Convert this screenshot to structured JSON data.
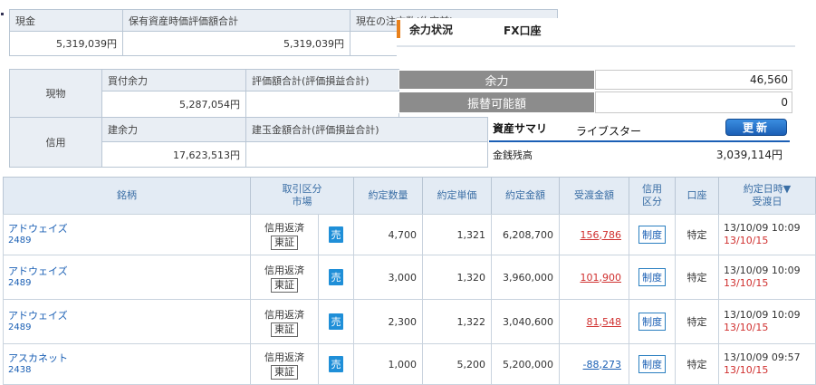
{
  "summary_top": {
    "cash_label": "現金",
    "cash_value": "5,319,039円",
    "holdings_label": "保有資産時価評価額合計",
    "holdings_value": "5,319,039円",
    "current_order_label": "現在の注文数(約定前)"
  },
  "margin_block": {
    "spot_label": "現物",
    "buy_power_label": "買付余力",
    "buy_power_value": "5,287,054円",
    "valuation_label": "評価額合計(評価損益合計)",
    "credit_label": "信用",
    "build_power_label": "建余力",
    "build_power_value": "17,623,513円",
    "position_label": "建玉金額合計(評価損益合計)"
  },
  "fx_panel": {
    "title": "余力状況",
    "account": "FX口座",
    "margin_label": "余力",
    "margin_value": "46,560",
    "transferable_label": "振替可能額",
    "transferable_value": "0",
    "asset_summary_label": "資産サマリ",
    "live_star": "ライブスター",
    "update_label": "更新",
    "cash_balance_label": "金銭残高",
    "cash_balance_value": "3,039,114円"
  },
  "trades_table": {
    "headers": {
      "stock": "銘柄",
      "trade_type_line1": "取引区分",
      "trade_type_line2": "市場",
      "qty": "約定数量",
      "price": "約定単価",
      "amount": "約定金額",
      "settlement": "受渡金額",
      "credit_line1": "信用",
      "credit_line2": "区分",
      "account": "口座",
      "date_line1": "約定日時▼",
      "date_line2": "受渡日"
    },
    "rows": [
      {
        "name": "アドウェイズ",
        "code": "2489",
        "trade_type": "信用返済",
        "market": "東証",
        "side": "売",
        "qty": "4,700",
        "price": "1,321",
        "amount": "6,208,700",
        "settlement": "156,786",
        "credit": "制度",
        "account": "特定",
        "exec_date": "13/10/09 10:09",
        "settle_date": "13/10/15"
      },
      {
        "name": "アドウェイズ",
        "code": "2489",
        "trade_type": "信用返済",
        "market": "東証",
        "side": "売",
        "qty": "3,000",
        "price": "1,320",
        "amount": "3,960,000",
        "settlement": "101,900",
        "credit": "制度",
        "account": "特定",
        "exec_date": "13/10/09 10:09",
        "settle_date": "13/10/15"
      },
      {
        "name": "アドウェイズ",
        "code": "2489",
        "trade_type": "信用返済",
        "market": "東証",
        "side": "売",
        "qty": "2,300",
        "price": "1,322",
        "amount": "3,040,600",
        "settlement": "81,548",
        "credit": "制度",
        "account": "特定",
        "exec_date": "13/10/09 10:09",
        "settle_date": "13/10/15"
      },
      {
        "name": "アスカネット",
        "code": "2438",
        "trade_type": "信用返済",
        "market": "東証",
        "side": "売",
        "qty": "1,000",
        "price": "5,200",
        "amount": "5,200,000",
        "settlement": "-88,273",
        "credit": "制度",
        "account": "特定",
        "exec_date": "13/10/09 09:57",
        "settle_date": "13/10/15"
      }
    ]
  },
  "colors": {
    "header_bg": "#e3ebf4",
    "border": "#b9c6d4",
    "link": "#1a5fb4",
    "profit_red": "#d0302f",
    "loss_blue": "#1a5fb4",
    "sell_blue": "#1f8fd8",
    "fx_gray": "#8c8c8c",
    "fx_accent": "#e8801a"
  }
}
